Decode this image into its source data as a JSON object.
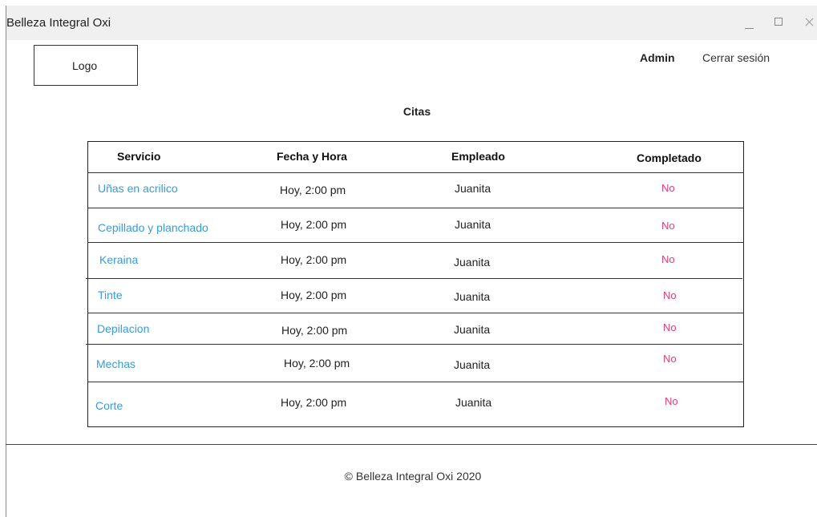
{
  "window": {
    "title": "Belleza Integral Oxi"
  },
  "header": {
    "logo": "Logo",
    "user": "Admin",
    "logout": "Cerrar sesión"
  },
  "page": {
    "title": "Citas"
  },
  "table": {
    "columns": [
      "Servicio",
      "Fecha y Hora",
      "Empleado",
      "Completado"
    ],
    "rows": [
      {
        "servicio": "Uñas en acrilico",
        "fecha": "Hoy, 2:00 pm",
        "empleado": "Juanita",
        "completado": "No"
      },
      {
        "servicio": "Cepillado y planchado",
        "fecha": "Hoy, 2:00 pm",
        "empleado": "Juanita",
        "completado": "No"
      },
      {
        "servicio": "Keraina",
        "fecha": "Hoy, 2:00 pm",
        "empleado": "Juanita",
        "completado": "No"
      },
      {
        "servicio": "Tinte",
        "fecha": "Hoy, 2:00 pm",
        "empleado": "Juanita",
        "completado": "No"
      },
      {
        "servicio": "Depilacion",
        "fecha": "Hoy, 2:00 pm",
        "empleado": "Juanita",
        "completado": "No"
      },
      {
        "servicio": "Mechas",
        "fecha": "Hoy, 2:00 pm",
        "empleado": "Juanita",
        "completado": "No"
      },
      {
        "servicio": "Corte",
        "fecha": "Hoy, 2:00 pm",
        "empleado": "Juanita",
        "completado": "No"
      }
    ]
  },
  "footer": {
    "text": "© Belleza Integral Oxi 2020"
  },
  "colors": {
    "link": "#3a9ad9",
    "status_no": "#e23b7e",
    "titlebar": "#f0f0f0"
  }
}
